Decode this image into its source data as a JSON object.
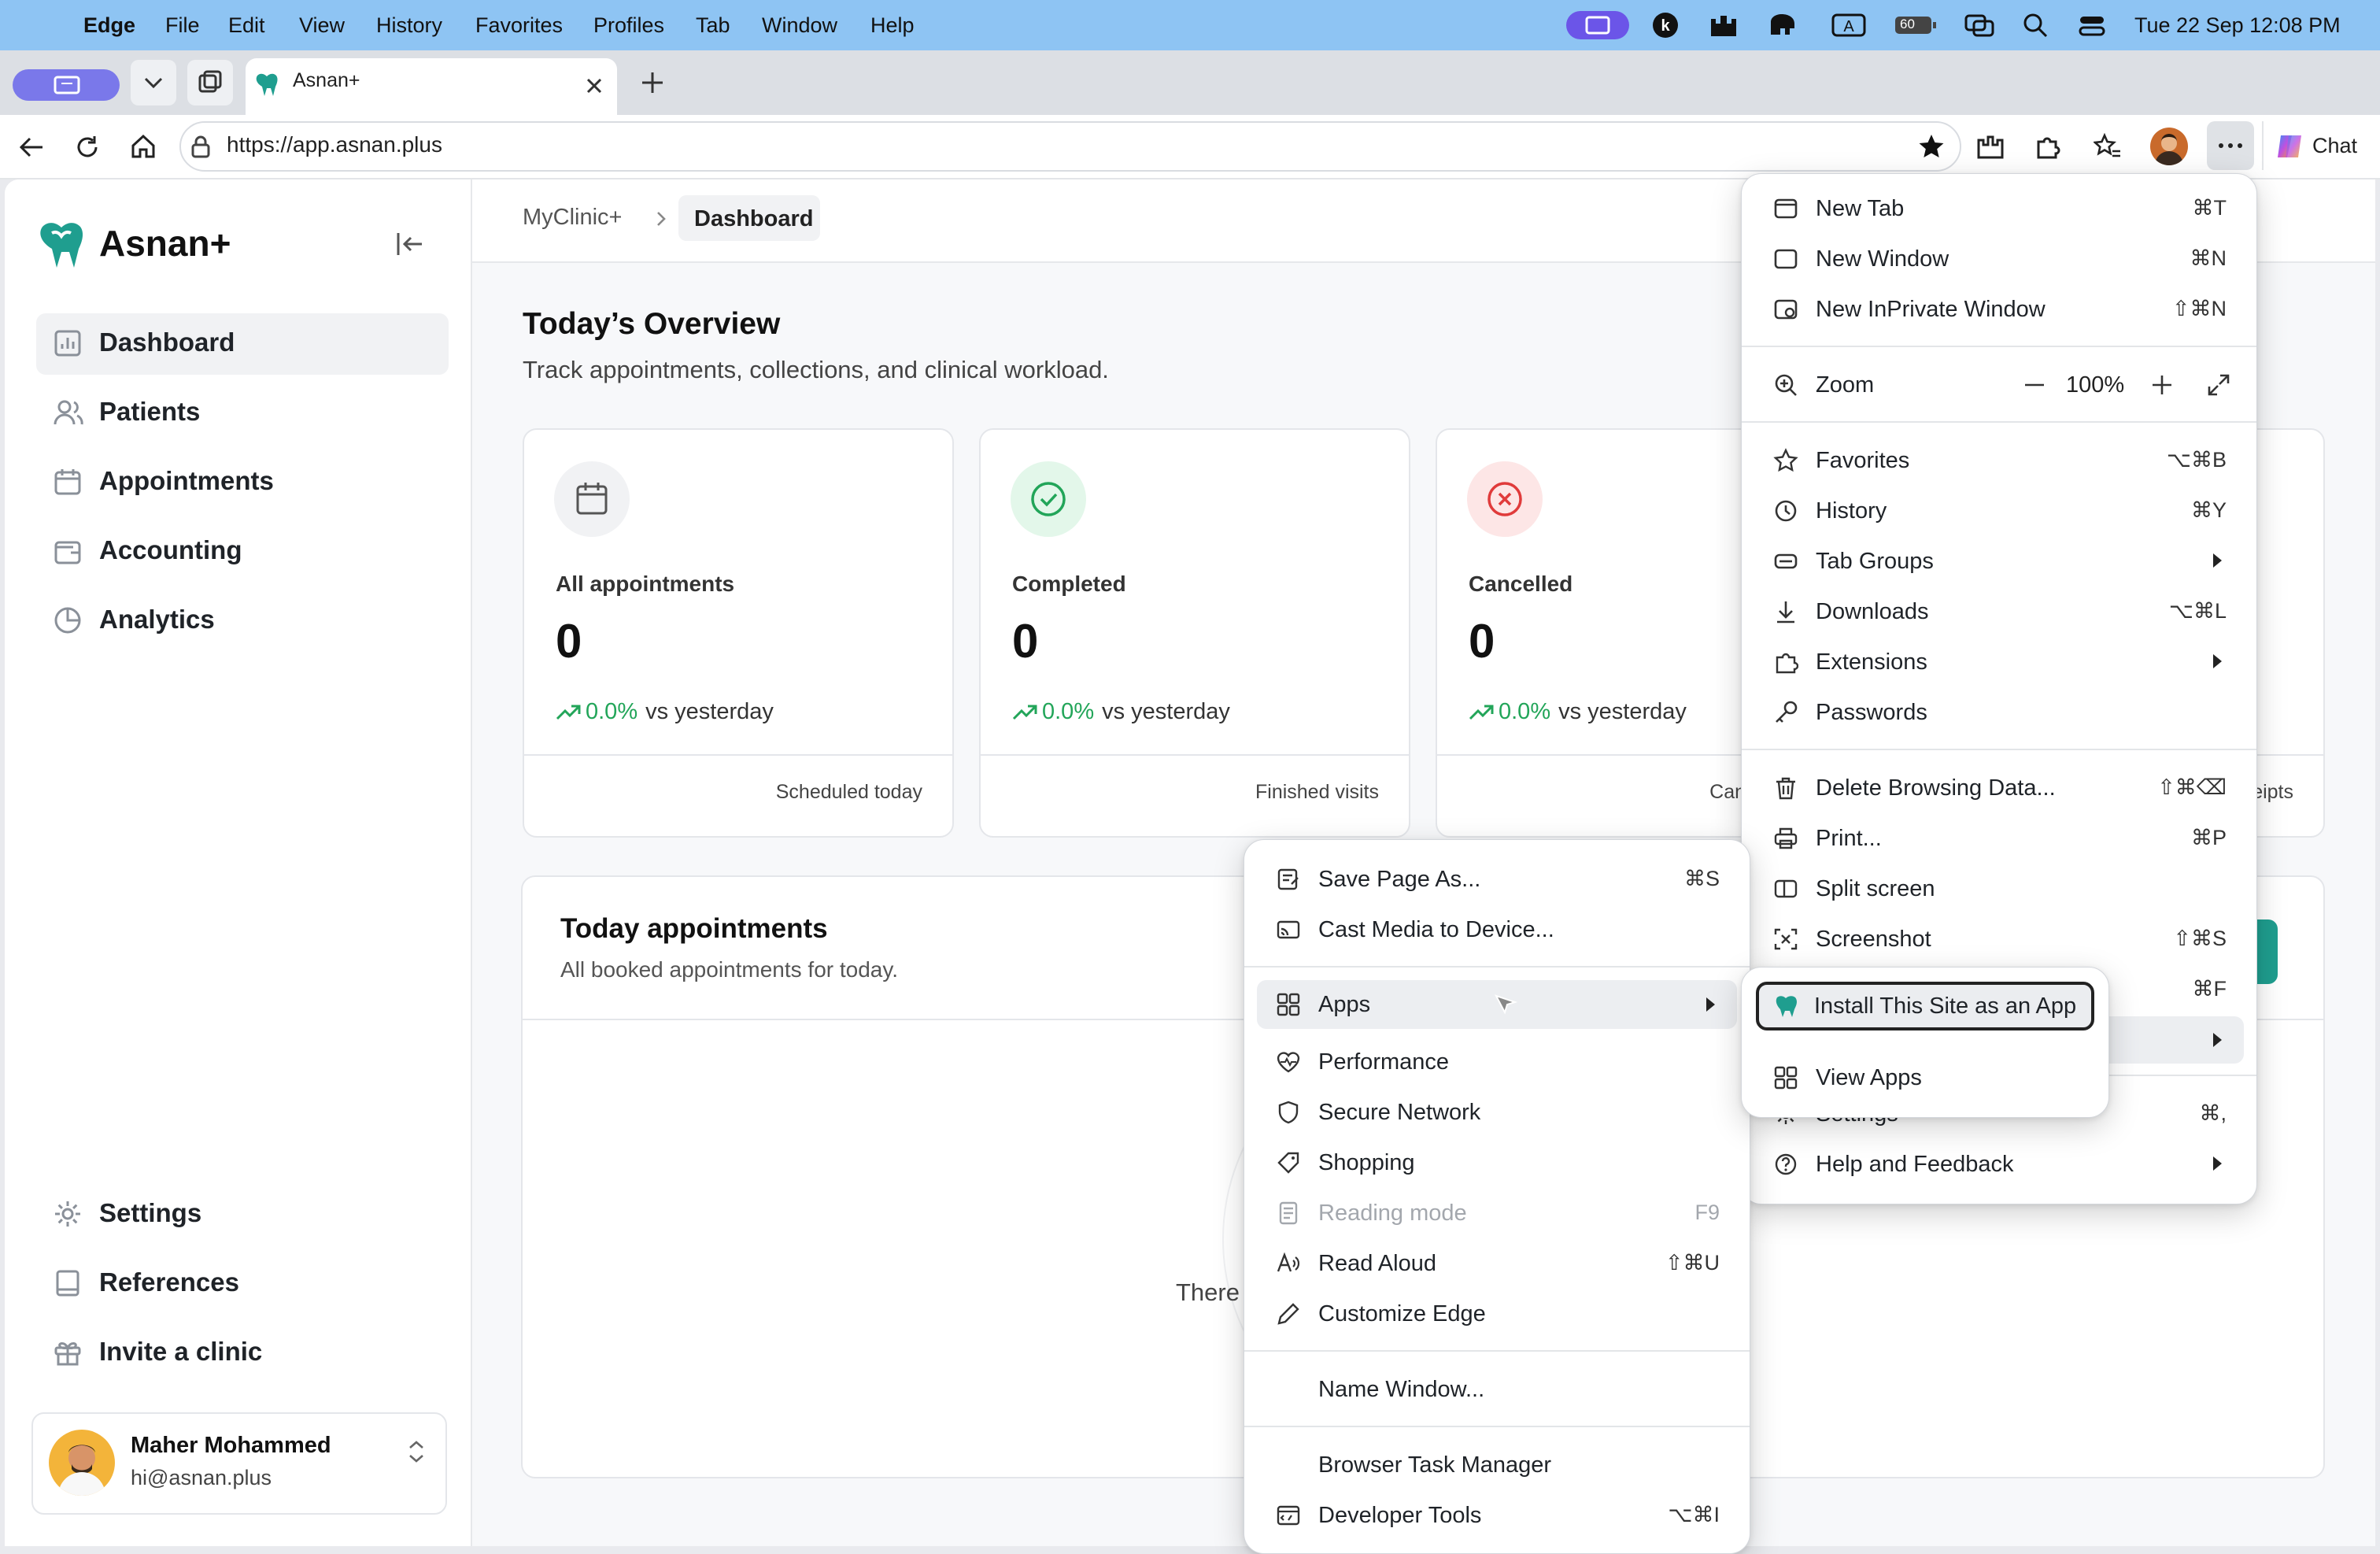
{
  "menubar": {
    "apple": "",
    "app": "Edge",
    "items": [
      "File",
      "Edit",
      "View",
      "History",
      "Favorites",
      "Profiles",
      "Tab",
      "Window",
      "Help"
    ],
    "clock": "Tue 22 Sep  12:08 PM",
    "battery": "60"
  },
  "tab": {
    "title": "Asnan+"
  },
  "toolbar": {
    "url": "https://app.asnan.plus",
    "chat_label": "Chat"
  },
  "sidebar": {
    "brand": "Asnan+",
    "items": [
      {
        "label": "Dashboard"
      },
      {
        "label": "Patients"
      },
      {
        "label": "Appointments"
      },
      {
        "label": "Accounting"
      },
      {
        "label": "Analytics"
      }
    ],
    "bottom": [
      {
        "label": "Settings"
      },
      {
        "label": "References"
      },
      {
        "label": "Invite a clinic"
      }
    ],
    "user": {
      "name": "Maher Mohammed",
      "email": "hi@asnan.plus"
    }
  },
  "breadcrumb": {
    "root": "MyClinic+",
    "current": "Dashboard"
  },
  "overview": {
    "title": "Today’s Overview",
    "subtitle": "Track appointments, collections, and clinical workload.",
    "cards": [
      {
        "label": "All appointments",
        "value": "0",
        "change": "0.0%",
        "vs": "vs yesterday",
        "footer": "Scheduled today",
        "color": "#f1f2f4"
      },
      {
        "label": "Completed",
        "value": "0",
        "change": "0.0%",
        "vs": "vs yesterday",
        "footer": "Finished visits",
        "color": "#e3f7ea"
      },
      {
        "label": "Cancelled",
        "value": "0",
        "change": "0.0%",
        "vs": "vs yesterday",
        "footer": "Cancelled app",
        "color": "#fde6e6"
      }
    ],
    "partial_footer": "eipts"
  },
  "appointments": {
    "title": "Today appointments",
    "subtitle": "All booked appointments for today.",
    "empty_text": "There"
  },
  "edge_menu": {
    "items": [
      {
        "label": "New Tab",
        "shortcut": "⌘T"
      },
      {
        "label": "New Window",
        "shortcut": "⌘N"
      },
      {
        "label": "New InPrivate Window",
        "shortcut": "⇧⌘N"
      },
      {
        "label": "Zoom",
        "zoom_value": "100%"
      },
      {
        "label": "Favorites",
        "shortcut": "⌥⌘B"
      },
      {
        "label": "History",
        "shortcut": "⌘Y"
      },
      {
        "label": "Tab Groups"
      },
      {
        "label": "Downloads",
        "shortcut": "⌥⌘L"
      },
      {
        "label": "Extensions"
      },
      {
        "label": "Passwords"
      },
      {
        "label": "Delete Browsing Data...",
        "shortcut": "⇧⌘⌫"
      },
      {
        "label": "Print...",
        "shortcut": "⌘P"
      },
      {
        "label": "Split screen"
      },
      {
        "label": "Screenshot",
        "shortcut": "⇧⌘S"
      },
      {
        "shortcut": "⌘F"
      },
      {
        "label": "Settings",
        "shortcut": "⌘,"
      },
      {
        "label": "Help and Feedback"
      }
    ]
  },
  "more_tools_menu": {
    "items": [
      {
        "label": "Save Page As...",
        "shortcut": "⌘S"
      },
      {
        "label": "Cast Media to Device..."
      },
      {
        "label": "Apps"
      },
      {
        "label": "Performance"
      },
      {
        "label": "Secure Network"
      },
      {
        "label": "Shopping"
      },
      {
        "label": "Reading mode",
        "shortcut": "F9"
      },
      {
        "label": "Read Aloud",
        "shortcut": "⇧⌘U"
      },
      {
        "label": "Customize Edge"
      },
      {
        "label": "Name Window..."
      },
      {
        "label": "Browser Task Manager"
      },
      {
        "label": "Developer Tools",
        "shortcut": "⌥⌘I"
      }
    ]
  },
  "apps_menu": {
    "items": [
      {
        "label": "Install This Site as an App"
      },
      {
        "label": "View Apps"
      }
    ]
  },
  "colors": {
    "accent": "#7a78ea",
    "teal": "#1f9e8f",
    "green": "#22a559",
    "red": "#e03b3b"
  }
}
